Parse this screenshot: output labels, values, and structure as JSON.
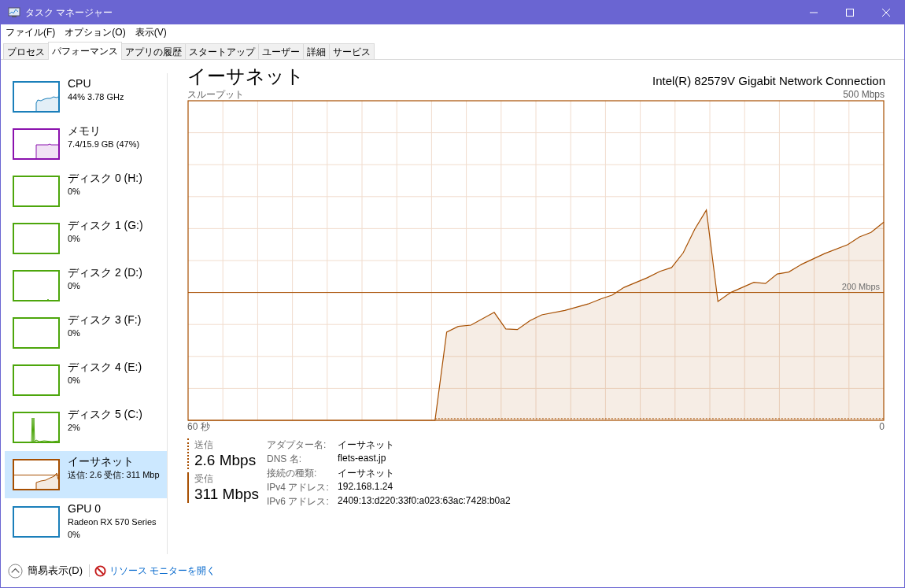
{
  "window": {
    "title": "タスク マネージャー"
  },
  "menu": [
    {
      "label": "ファイル(F)"
    },
    {
      "label": "オプション(O)"
    },
    {
      "label": "表示(V)"
    }
  ],
  "tabs": [
    {
      "label": "プロセス",
      "selected": false
    },
    {
      "label": "パフォーマンス",
      "selected": true
    },
    {
      "label": "アプリの履歴",
      "selected": false
    },
    {
      "label": "スタートアップ",
      "selected": false
    },
    {
      "label": "ユーザー",
      "selected": false
    },
    {
      "label": "詳細",
      "selected": false
    },
    {
      "label": "サービス",
      "selected": false
    }
  ],
  "sidebar": {
    "items": [
      {
        "kind": "cpu",
        "name": "CPU",
        "details": [
          "44%  3.78 GHz"
        ],
        "color": "#1b7fba",
        "selected": false
      },
      {
        "kind": "memory",
        "name": "メモリ",
        "details": [
          "7.4/15.9 GB (47%)"
        ],
        "color": "#8b12ae",
        "selected": false
      },
      {
        "kind": "disk-idle",
        "name": "ディスク 0 (H:)",
        "details": [
          "0%"
        ],
        "color": "#4da60c",
        "selected": false
      },
      {
        "kind": "disk-idle",
        "name": "ディスク 1 (G:)",
        "details": [
          "0%"
        ],
        "color": "#4da60c",
        "selected": false
      },
      {
        "kind": "disk-blip",
        "name": "ディスク 2 (D:)",
        "details": [
          "0%"
        ],
        "color": "#4da60c",
        "selected": false
      },
      {
        "kind": "disk-idle",
        "name": "ディスク 3 (F:)",
        "details": [
          "0%"
        ],
        "color": "#4da60c",
        "selected": false
      },
      {
        "kind": "disk-idle",
        "name": "ディスク 4 (E:)",
        "details": [
          "0%"
        ],
        "color": "#4da60c",
        "selected": false
      },
      {
        "kind": "disk-active",
        "name": "ディスク 5 (C:)",
        "details": [
          "2%"
        ],
        "color": "#4da60c",
        "selected": false
      },
      {
        "kind": "ethernet",
        "name": "イーサネット",
        "details": [
          "送信: 2.6 受信: 311 Mbp"
        ],
        "color": "#a74f01",
        "selected": true
      },
      {
        "kind": "gpu",
        "name": "GPU 0",
        "details": [
          "Radeon RX 570 Series",
          "0%"
        ],
        "color": "#1b7fba",
        "selected": false
      }
    ]
  },
  "main": {
    "title": "イーサネット",
    "adapter_model": "Intel(R) 82579V Gigabit Network Connection",
    "graph": {
      "label": "スループット",
      "max_label": "500 Mbps",
      "line_label": "200 Mbps",
      "time_start": "60 秒",
      "time_end": "0"
    }
  },
  "stats": [
    {
      "kind": "dashed",
      "label": "送信",
      "value": "2.6 Mbps"
    },
    {
      "kind": "solid",
      "label": "受信",
      "value": "311 Mbps"
    }
  ],
  "properties": [
    {
      "key": "アダプター名:",
      "value": "イーサネット"
    },
    {
      "key": "DNS 名:",
      "value": "flets-east.jp"
    },
    {
      "key": "接続の種類:",
      "value": "イーサネット"
    },
    {
      "key": "IPv4 アドレス:",
      "value": "192.168.1.24"
    },
    {
      "key": "IPv6 アドレス:",
      "value": "2409:13:d220:33f0:a023:63ac:7428:b0a2"
    }
  ],
  "footer": {
    "fewer_details": "簡易表示(D)",
    "resource_monitor": "リソース モニターを開く"
  }
}
